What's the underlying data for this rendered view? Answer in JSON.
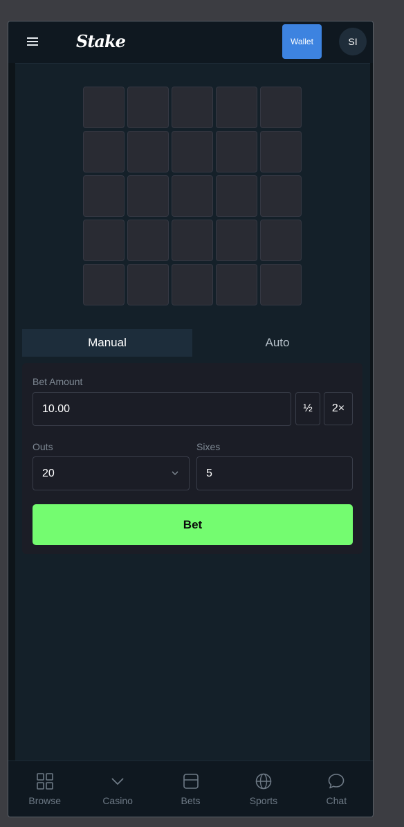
{
  "header": {
    "logo": "Stake",
    "wallet_label": "Wallet",
    "avatar_initials": "SI"
  },
  "game": {
    "rows": 5,
    "cols": 5
  },
  "tabs": [
    {
      "label": "Manual",
      "active": true
    },
    {
      "label": "Auto",
      "active": false
    }
  ],
  "form": {
    "bet_amount_label": "Bet Amount",
    "bet_amount_value": "10.00",
    "half_label": "½",
    "double_label": "2×",
    "outs_label": "Outs",
    "outs_value": "20",
    "sixes_label": "Sixes",
    "sixes_value": "5",
    "bet_button_label": "Bet"
  },
  "nav": [
    {
      "label": "Browse",
      "icon": "grid-icon"
    },
    {
      "label": "Casino",
      "icon": "chevron-down-icon"
    },
    {
      "label": "Bets",
      "icon": "ticket-icon"
    },
    {
      "label": "Sports",
      "icon": "globe-icon"
    },
    {
      "label": "Chat",
      "icon": "chat-bubble-icon"
    }
  ],
  "colors": {
    "accent_green": "#74fc70",
    "wallet_blue": "#3d83e0",
    "background": "#142029"
  }
}
